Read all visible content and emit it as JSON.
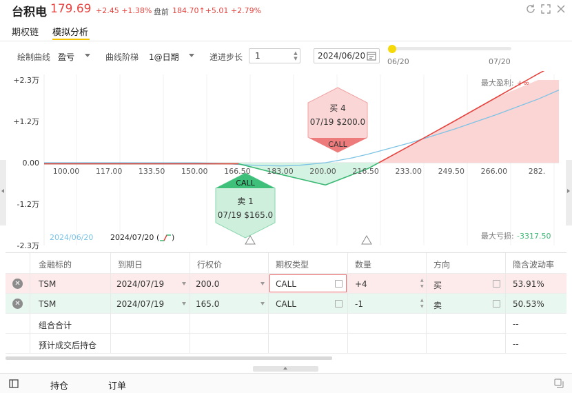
{
  "header": {
    "name": "台积电",
    "price": "179.69",
    "change": "+2.45 +1.38%",
    "pre_label": "盘前",
    "pre_value": "184.70↑+5.01 +2.79%"
  },
  "tabs": [
    {
      "label": "期权链"
    },
    {
      "label": "模拟分析"
    }
  ],
  "controls": {
    "curve_label": "绘制曲线",
    "curve_value": "盈亏",
    "step_label": "曲线阶梯",
    "step_value": "1@日期",
    "increment_label": "递进步长",
    "increment_value": "1",
    "date_value": "2024/06/20",
    "slider_start": "06/20",
    "slider_end": "07/20",
    "slider_fraction": 0.0
  },
  "chart_data": {
    "type": "line",
    "ytick_labels": [
      "+2.3万",
      "+1.2万",
      "0.00",
      "-1.2万",
      "-2.3万"
    ],
    "ylim": [
      -23000,
      23000
    ],
    "xtick_labels": [
      "100.00",
      "117.00",
      "133.50",
      "150.00",
      "166.50",
      "183.00",
      "200.00",
      "216.50",
      "233.00",
      "249.50",
      "266.00",
      "282."
    ],
    "xlim": [
      91.5,
      290
    ],
    "series": [
      {
        "name": "2024/06/20",
        "color": "#7cc3e6",
        "x": [
          91.5,
          150,
          160,
          166.5,
          175,
          183,
          190,
          200,
          210,
          216.5,
          233,
          249.5,
          266,
          282,
          290
        ],
        "y": [
          0,
          -40,
          -220,
          -470,
          -780,
          -900,
          -700,
          0,
          1300,
          2400,
          5600,
          9300,
          13400,
          17700,
          20200
        ]
      },
      {
        "name": "2024/07/20",
        "color": "#e5443f",
        "x": [
          91.5,
          150,
          166.5,
          183,
          200,
          216.5,
          233,
          249.5,
          266,
          282,
          290
        ],
        "y": [
          -300,
          -300,
          -300,
          -3300,
          -6200,
          -1600,
          4900,
          11500,
          18200,
          24700,
          27800
        ]
      }
    ],
    "max_profit_label": "最大盈利:",
    "max_profit_value": "+∞",
    "max_loss_label": "最大亏损:",
    "max_loss_value": "-3317.50",
    "legend": [
      "2024/06/20",
      "2024/07/20"
    ],
    "markers": [
      {
        "title": "买 4",
        "detail": "07/19 $200.0",
        "tag": "CALL",
        "strike": 200.0,
        "side": "buy"
      },
      {
        "title": "卖 1",
        "detail": "07/19 $165.0",
        "tag": "CALL",
        "strike": 166.5,
        "side": "sell"
      }
    ]
  },
  "table": {
    "headers": [
      "金融标的",
      "到期日",
      "行权价",
      "期权类型",
      "数量",
      "方向",
      "隐含波动率"
    ],
    "rows": [
      {
        "symbol": "TSM",
        "expiry": "2024/07/19",
        "strike": "200.0",
        "type": "CALL",
        "qty": "+4",
        "dir": "买",
        "iv": "53.91%",
        "side": "buy"
      },
      {
        "symbol": "TSM",
        "expiry": "2024/07/19",
        "strike": "165.0",
        "type": "CALL",
        "qty": "-1",
        "dir": "卖",
        "iv": "50.53%",
        "side": "sell"
      }
    ],
    "total_label": "组合合计",
    "total_iv": "--",
    "post_label": "预计成交后持仓",
    "post_iv": "--"
  },
  "bottom": {
    "positions": "持仓",
    "orders": "订单"
  },
  "colors": {
    "up": "#e5443f",
    "down": "#3bb874",
    "accent": "#f5c400"
  }
}
